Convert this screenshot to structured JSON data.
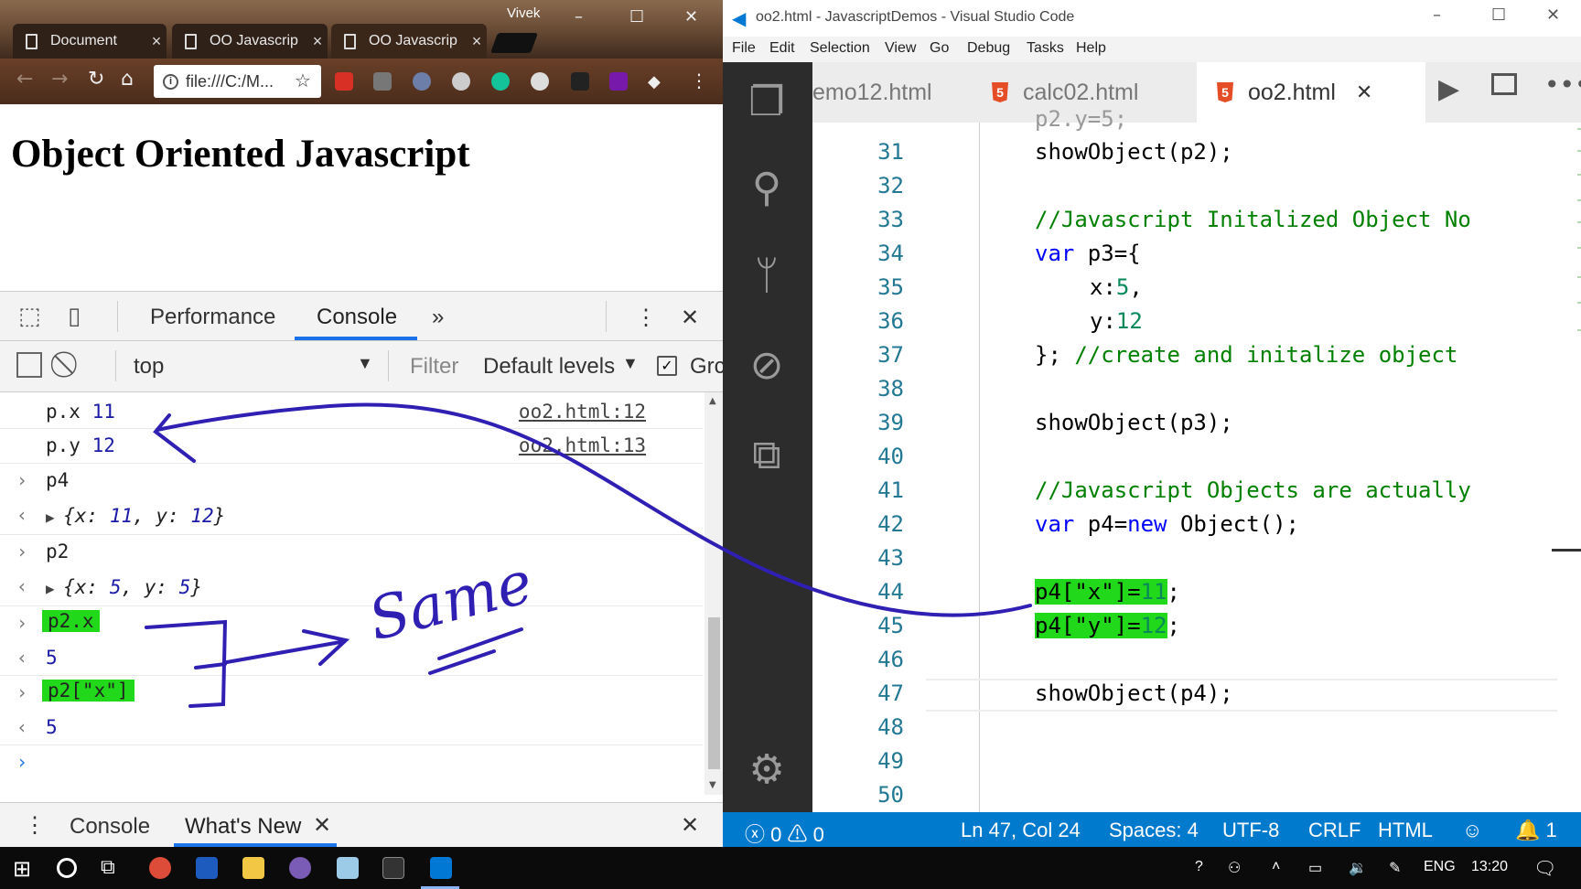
{
  "chrome": {
    "user": "Vivek",
    "tabs": [
      {
        "title": "Document",
        "close": "×"
      },
      {
        "title": "OO Javascrip",
        "close": "×"
      },
      {
        "title": "OO Javascrip",
        "close": "×"
      }
    ],
    "address": "file:///C:/M...",
    "page_heading": "Object Oriented Javascript",
    "colors": {
      "accent": "#1a73e8"
    }
  },
  "devtools": {
    "tabs": [
      "Performance",
      "Console"
    ],
    "more": "»",
    "context": "top",
    "filter_placeholder": "Filter",
    "levels": "Default levels",
    "group_label": "Grc",
    "console_lines": [
      {
        "kind": "log",
        "label": "p.x",
        "value": "11",
        "source": "oo2.html:12"
      },
      {
        "kind": "log",
        "label": "p.y",
        "value": "12",
        "source": "oo2.html:13"
      },
      {
        "kind": "input",
        "text": "p4"
      },
      {
        "kind": "output",
        "text_pre": "{x: ",
        "v1": "11",
        "mid": ", y: ",
        "v2": "12",
        "post": "}"
      },
      {
        "kind": "input",
        "text": "p2"
      },
      {
        "kind": "output",
        "text_pre": "{x: ",
        "v1": "5",
        "mid": ", y: ",
        "v2": "5",
        "post": "}"
      },
      {
        "kind": "input",
        "text": "p2.x"
      },
      {
        "kind": "result",
        "text": "5"
      },
      {
        "kind": "input",
        "text": "p2[\"x\"]"
      },
      {
        "kind": "result",
        "text": "5"
      }
    ],
    "drawer_tabs": [
      "Console",
      "What's New"
    ]
  },
  "vscode": {
    "title": "oo2.html - JavascriptDemos - Visual Studio Code",
    "menu": [
      "File",
      "Edit",
      "Selection",
      "View",
      "Go",
      "Debug",
      "Tasks",
      "Help"
    ],
    "tabs": [
      "emo12.html",
      "calc02.html",
      "oo2.html"
    ],
    "line_numbers": [
      "31",
      "32",
      "33",
      "34",
      "35",
      "36",
      "37",
      "38",
      "39",
      "40",
      "41",
      "42",
      "43",
      "44",
      "45",
      "46",
      "47",
      "48",
      "49",
      "50"
    ],
    "code": {
      "l31": "showObject(p2);",
      "l33": "//Javascript Initalized Object No",
      "l34_kw": "var",
      "l34": " p3={",
      "l35_key": "x:",
      "l35_val": "5",
      "l35_end": ",",
      "l36_key": "y:",
      "l36_val": "12",
      "l37": "}; ",
      "l37_cm": "//create and initalize object",
      "l39": "showObject(p3);",
      "l41": "//Javascript Objects are actually",
      "l42_kw": "var",
      "l42_a": " p4=",
      "l42_kw2": "new",
      "l42_b": " Object();",
      "l44_hl": "p4[\"x\"]=",
      "l44_num": "11",
      "l44_end": ";",
      "l45_hl": "p4[\"y\"]=",
      "l45_num": "12",
      "l45_end": ";",
      "l47": "showObject(p4);"
    },
    "status": {
      "errors": "0",
      "warnings": "0",
      "position": "Ln 47, Col 24",
      "spaces": "Spaces: 4",
      "encoding": "UTF-8",
      "eol": "CRLF",
      "language": "HTML",
      "notifications": "1"
    },
    "colors": {
      "statusbar": "#007acc",
      "highlight": "#22d81a"
    }
  },
  "annotation": {
    "text": "Same"
  },
  "taskbar": {
    "lang": "ENG",
    "time": "13:20"
  }
}
